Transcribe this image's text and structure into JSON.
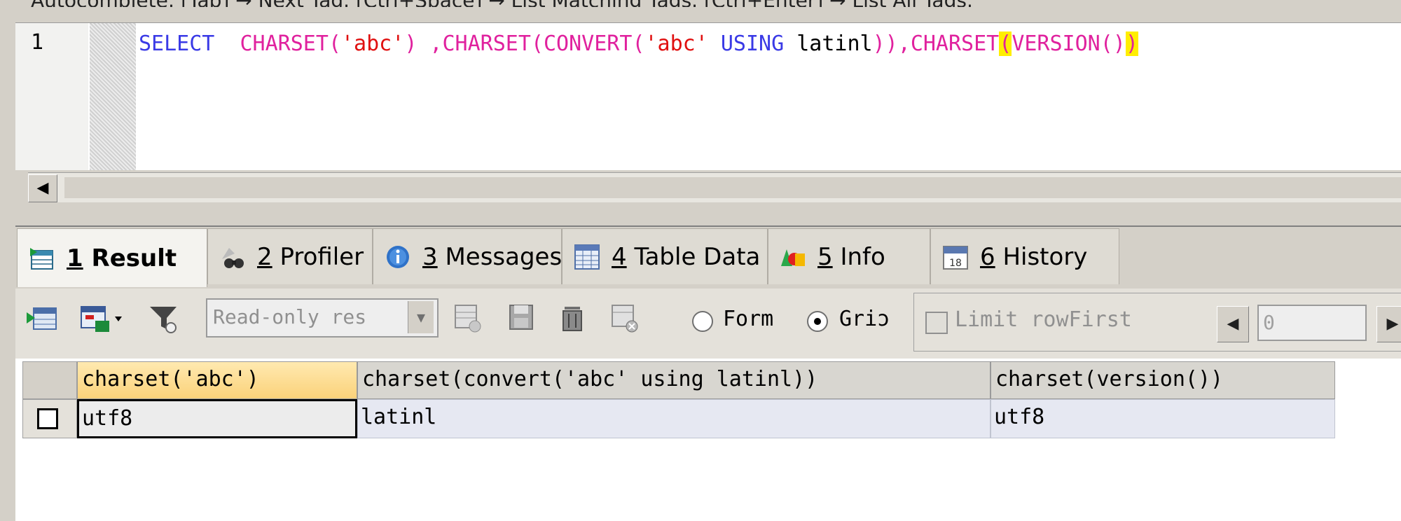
{
  "status_line": "Autocomplete: [Tab] → Next Tag. [Ctrl+Space] → List Matching Tags. [Ctrl+Enter] → List All Tags.",
  "editor": {
    "line_number": "1",
    "sql_tokens": [
      {
        "t": "SELECT",
        "c": "kw"
      },
      {
        "t": "  ",
        "c": "pl"
      },
      {
        "t": "CHARSET",
        "c": "fn"
      },
      {
        "t": "(",
        "c": "fn"
      },
      {
        "t": "'abc'",
        "c": "st"
      },
      {
        "t": ")",
        "c": "fn"
      },
      {
        "t": " ,",
        "c": "fn"
      },
      {
        "t": "CHARSET",
        "c": "fn"
      },
      {
        "t": "(",
        "c": "fn"
      },
      {
        "t": "CONVERT",
        "c": "fn"
      },
      {
        "t": "(",
        "c": "fn"
      },
      {
        "t": "'abc'",
        "c": "st"
      },
      {
        "t": " ",
        "c": "pl"
      },
      {
        "t": "USING",
        "c": "kw"
      },
      {
        "t": " latinl",
        "c": "pl"
      },
      {
        "t": ")),",
        "c": "fn"
      },
      {
        "t": "CHARSET",
        "c": "fn"
      },
      {
        "t": "(",
        "c": "fn hl"
      },
      {
        "t": "VERSION",
        "c": "fn"
      },
      {
        "t": "()",
        "c": "fn"
      },
      {
        "t": ")",
        "c": "fn hl"
      }
    ]
  },
  "scrollbar": {
    "left_arrow": "◀"
  },
  "tabs": [
    {
      "num": "1",
      "label": "Result",
      "active": true,
      "icon": "result-icon"
    },
    {
      "num": "2",
      "label": "Profiler",
      "active": false,
      "icon": "profiler-icon"
    },
    {
      "num": "3",
      "label": "Messages",
      "active": false,
      "icon": "info-icon"
    },
    {
      "num": "4",
      "label": "Table Data",
      "active": false,
      "icon": "table-icon"
    },
    {
      "num": "5",
      "label": "Info",
      "active": false,
      "icon": "shapes-icon"
    },
    {
      "num": "6",
      "label": "History",
      "active": false,
      "icon": "calendar-icon"
    }
  ],
  "calendar_day": "18",
  "toolbar": {
    "mode_dropdown": "Read-only res",
    "dropdown_arrow": "▼",
    "radio_form": "Form",
    "radio_grid": "Griɔ",
    "limit_label": "Limit rowFirst",
    "first_value": "0",
    "prev_arrow": "◀",
    "next_arrow": "▶"
  },
  "grid": {
    "columns": [
      "charset('abc')",
      "charset(convert('abc' using latinl))",
      "charset(version())"
    ],
    "rows": [
      [
        "utf8",
        "latinl",
        "utf8"
      ]
    ]
  },
  "colors": {
    "keyword": "#3a3ae6",
    "function": "#e0219e",
    "string": "#e01010",
    "bracket_highlight": "#ffee00",
    "selected_header": "#fbd27a",
    "row_background": "#e6e8f2"
  }
}
